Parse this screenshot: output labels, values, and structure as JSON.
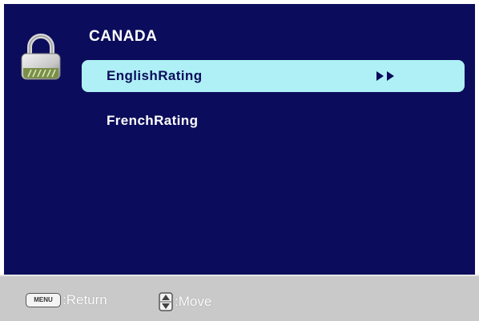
{
  "menu": {
    "title": "CANADA",
    "items": [
      {
        "label": "EnglishRating",
        "selected": true,
        "has_submenu": true
      },
      {
        "label": "FrenchRating",
        "selected": false,
        "has_submenu": false
      }
    ]
  },
  "footer": {
    "return_key": "MENU",
    "return_label": ":Return",
    "move_label": ":Move"
  },
  "icons": {
    "header": "padlock-icon",
    "submenu": "double-right-arrow-icon",
    "move": "up-down-key-icon"
  },
  "colors": {
    "background": "#0c0c5c",
    "highlight": "#aef0f6",
    "footer": "#c9c9c9"
  }
}
